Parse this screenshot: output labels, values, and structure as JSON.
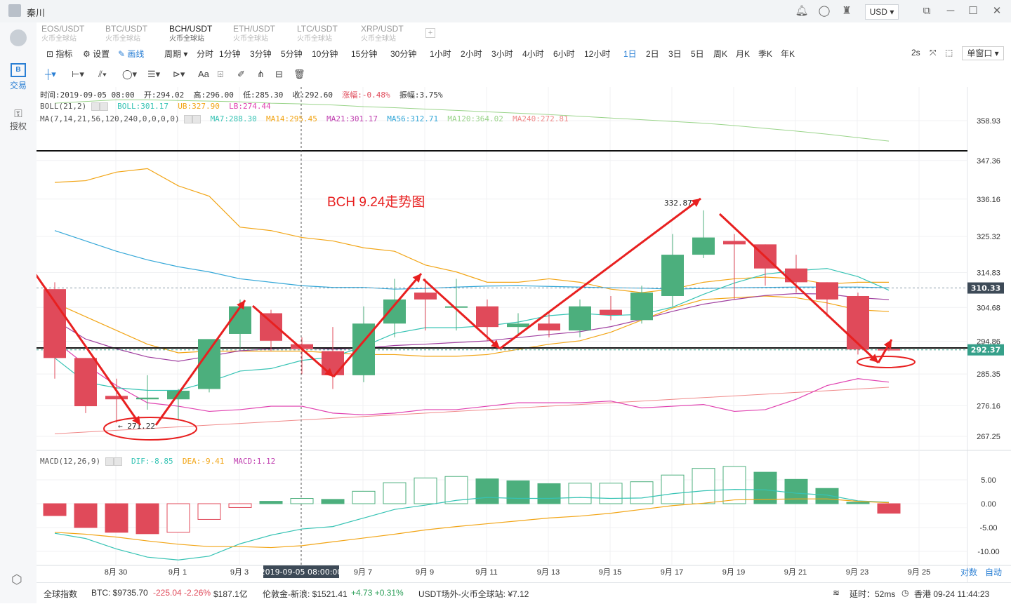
{
  "window": {
    "user": "秦川",
    "currency": "USD",
    "icons": [
      "bell-icon",
      "chat-icon",
      "shirt-icon"
    ]
  },
  "sidebar": {
    "items": [
      {
        "label": "交易",
        "icon": "B"
      },
      {
        "label": "授权",
        "icon": "key-icon"
      }
    ]
  },
  "tabs": [
    {
      "symbol": "EOS/USDT",
      "source": "火币全球站"
    },
    {
      "symbol": "BTC/USDT",
      "source": "火币全球站"
    },
    {
      "symbol": "BCH/USDT",
      "source": "火币全球站"
    },
    {
      "symbol": "ETH/USDT",
      "source": "火币全球站"
    },
    {
      "symbol": "LTC/USDT",
      "source": "火币全球站"
    },
    {
      "symbol": "XRP/USDT",
      "source": "火币全球站"
    }
  ],
  "toolbar": {
    "indicator": "指标",
    "settings": "设置",
    "draw": "画线",
    "period_label": "周期",
    "periods": [
      "分时",
      "1分钟",
      "3分钟",
      "5分钟",
      "10分钟",
      "15分钟",
      "30分钟",
      "1小时",
      "2小时",
      "3小时",
      "4小时",
      "6小时",
      "12小时",
      "1日",
      "2日",
      "3日",
      "5日",
      "周K",
      "月K",
      "季K",
      "年K"
    ],
    "active_period": "1日",
    "refresh": "2s",
    "window_mode": "单窗口"
  },
  "info": {
    "row1": [
      "时间:2019-09-05 08:00",
      "开:294.02",
      "高:296.00",
      "低:285.30",
      "收:292.60",
      "涨幅:-0.48%",
      "振幅:3.75%"
    ],
    "boll_label": "BOLL(21,2)",
    "boll": [
      "BOLL:301.17",
      "UB:327.90",
      "LB:274.44"
    ],
    "ma_label": "MA(7,14,21,56,120,240,0,0,0,0)",
    "ma": [
      "MA7:288.30",
      "MA14:295.45",
      "MA21:301.17",
      "MA56:312.71",
      "MA120:364.02",
      "MA240:272.81"
    ],
    "macd_label": "MACD(12,26,9)",
    "macd": [
      "DIF:-8.85",
      "DEA:-9.41",
      "MACD:1.12"
    ]
  },
  "colors": {
    "up": "#4caf7d",
    "down": "#e04a5a",
    "boll": "#f2a516",
    "ub": "#f2a516",
    "lb": "#e040b0",
    "ma7": "#36c3b4",
    "ma14": "#f2a516",
    "ma21": "#a040a0",
    "ma56": "#36a8d8",
    "ma120": "#9ad48a",
    "ma240": "#f08a8a",
    "annot": "#e82020"
  },
  "chart_data": {
    "type": "candlestick",
    "title": "BCH 9.24走势图",
    "y_ticks": [
      "358.93",
      "347.36",
      "336.16",
      "325.32",
      "314.83",
      "304.68",
      "294.86",
      "285.35",
      "276.16",
      "267.25"
    ],
    "x_ticks": [
      "8月 30",
      "9月 1",
      "9月 3",
      "9月 7",
      "9月 9",
      "9月 11",
      "9月 13",
      "9月 15",
      "9月 17",
      "9月 19",
      "9月 21",
      "9月 23",
      "9月 25"
    ],
    "crosshair_label": "2019-09-05 08:00:00",
    "last_price": "292.37",
    "hline_price": "310.33",
    "high_label": "332.87",
    "low_label": "← 271.22",
    "macd_ticks": [
      "5.00",
      "0.00",
      "-5.00",
      "-10.00"
    ],
    "candles": [
      {
        "o": 310,
        "h": 312,
        "l": 284,
        "c": 290
      },
      {
        "o": 290,
        "h": 290,
        "l": 274,
        "c": 276
      },
      {
        "o": 279,
        "h": 284,
        "l": 271.22,
        "c": 278
      },
      {
        "o": 278,
        "h": 285,
        "l": 275,
        "c": 278.5
      },
      {
        "o": 278,
        "h": 281,
        "l": 272,
        "c": 280.5
      },
      {
        "o": 281,
        "h": 295,
        "l": 280,
        "c": 295.5
      },
      {
        "o": 297,
        "h": 307,
        "l": 293,
        "c": 305
      },
      {
        "o": 303,
        "h": 304,
        "l": 292,
        "c": 295
      },
      {
        "o": 294,
        "h": 296,
        "l": 285.3,
        "c": 292.6
      },
      {
        "o": 292,
        "h": 299,
        "l": 281,
        "c": 285
      },
      {
        "o": 285,
        "h": 305,
        "l": 283,
        "c": 300
      },
      {
        "o": 300,
        "h": 313,
        "l": 296,
        "c": 307
      },
      {
        "o": 309,
        "h": 313,
        "l": 298,
        "c": 307
      },
      {
        "o": 305,
        "h": 313,
        "l": 298,
        "c": 305
      },
      {
        "o": 305,
        "h": 307,
        "l": 295,
        "c": 299
      },
      {
        "o": 299,
        "h": 303,
        "l": 297,
        "c": 300
      },
      {
        "o": 300,
        "h": 303,
        "l": 296,
        "c": 298
      },
      {
        "o": 298,
        "h": 307,
        "l": 296,
        "c": 305
      },
      {
        "o": 304,
        "h": 308,
        "l": 301,
        "c": 302.5
      },
      {
        "o": 301,
        "h": 311,
        "l": 300,
        "c": 309
      },
      {
        "o": 308,
        "h": 326,
        "l": 305,
        "c": 320
      },
      {
        "o": 320,
        "h": 332.87,
        "l": 319,
        "c": 325
      },
      {
        "o": 324,
        "h": 326,
        "l": 307,
        "c": 323
      },
      {
        "o": 323,
        "h": 323,
        "l": 311,
        "c": 316
      },
      {
        "o": 316,
        "h": 320,
        "l": 309,
        "c": 312
      },
      {
        "o": 312,
        "h": 312,
        "l": 302,
        "c": 307
      },
      {
        "o": 308,
        "h": 309,
        "l": 291,
        "c": 292.5
      },
      {
        "o": 292.6,
        "h": 293,
        "l": 292,
        "c": 292.37
      }
    ],
    "macd_hist": [
      -2.5,
      -5,
      -6,
      -6.3,
      -6,
      -3.3,
      -0.8,
      0.5,
      1.1,
      0.9,
      2.6,
      4.4,
      5.4,
      5.7,
      5.2,
      4.8,
      4.2,
      4.3,
      4.3,
      4.6,
      6.0,
      7.4,
      7.8,
      6.6,
      5.1,
      3.2,
      0.3,
      -2.0
    ],
    "dif": [
      -6.2,
      -7.3,
      -9.5,
      -11.2,
      -11.8,
      -11.0,
      -8.4,
      -6.6,
      -5.3,
      -4.8,
      -3.0,
      -1.2,
      -0.3,
      0.7,
      1.3,
      1.1,
      1.1,
      1.3,
      1.1,
      1.2,
      2.1,
      2.7,
      3.0,
      2.9,
      2.2,
      1.8,
      0.6,
      0.3
    ],
    "dea": [
      -6.0,
      -6.4,
      -7.0,
      -7.8,
      -8.5,
      -9.0,
      -9.0,
      -9.2,
      -8.8,
      -8.0,
      -7.2,
      -6.4,
      -5.5,
      -4.8,
      -4.2,
      -3.6,
      -3.0,
      -2.6,
      -2.0,
      -1.2,
      -0.4,
      0.1,
      0.8,
      0.9,
      1.0,
      1.0,
      0.5,
      0.2
    ],
    "ub": [
      341,
      341.5,
      344,
      345,
      340,
      337,
      328,
      327,
      325,
      324,
      322,
      321,
      317,
      315,
      312,
      312,
      313,
      312,
      310,
      309,
      310,
      312,
      313,
      313.5,
      313,
      311.5,
      312,
      312
    ],
    "mid": [
      306,
      302,
      298,
      294,
      291.5,
      292,
      292,
      292,
      292,
      291.5,
      291,
      291,
      290.5,
      290.5,
      291,
      292.5,
      294,
      295,
      297.5,
      301,
      304.5,
      307,
      307.5,
      308,
      307.5,
      306,
      304,
      303.5
    ],
    "lb": [
      295,
      288,
      282,
      277,
      276,
      274.5,
      275,
      276,
      276,
      274,
      273.5,
      274,
      275,
      275,
      276,
      277,
      277,
      277,
      277.5,
      275.5,
      276,
      276.5,
      274.5,
      275,
      278,
      282,
      284,
      283
    ],
    "ma56": [
      327,
      324,
      321,
      318.5,
      316.5,
      315,
      313,
      312,
      311,
      310.5,
      310.5,
      310,
      310.2,
      310.6,
      310.9,
      311,
      310.8,
      310.6,
      310.4,
      310.3,
      310,
      310.2,
      310.4,
      310.5,
      310.6,
      310.6,
      310.6,
      310.4
    ],
    "ma120": [
      364,
      364.5,
      365,
      365,
      364.8,
      364.6,
      364.4,
      364,
      363.8,
      363.5,
      363,
      362.7,
      362.3,
      361.9,
      361.5,
      361.1,
      360.7,
      360.2,
      359.7,
      359.2,
      358.7,
      358.2,
      357.5,
      356.7,
      355.9,
      355,
      354,
      353
    ],
    "ma240": [
      268,
      268.5,
      269,
      269.5,
      270,
      270.5,
      271,
      271.5,
      272,
      272.5,
      273,
      273.5,
      274,
      274.5,
      275,
      275.5,
      276,
      276.5,
      277,
      277.5,
      278,
      278.5,
      279,
      279.5,
      280,
      280.5,
      281,
      281.5
    ]
  },
  "statusbar": {
    "index_label": "全球指数",
    "btc": "BTC: $9735.70",
    "btc_chg": "-225.04 -2.26%",
    "btc_vol": "$187.1亿",
    "gold": "伦敦金-新浪: $1521.41",
    "gold_chg": "+4.73 +0.31%",
    "usdt": "USDT场外-火币全球站: ¥7.12",
    "latency": "延时：52ms",
    "clock": "香港 09-24 11:44:23"
  },
  "bottom_links": [
    "对数",
    "自动"
  ]
}
